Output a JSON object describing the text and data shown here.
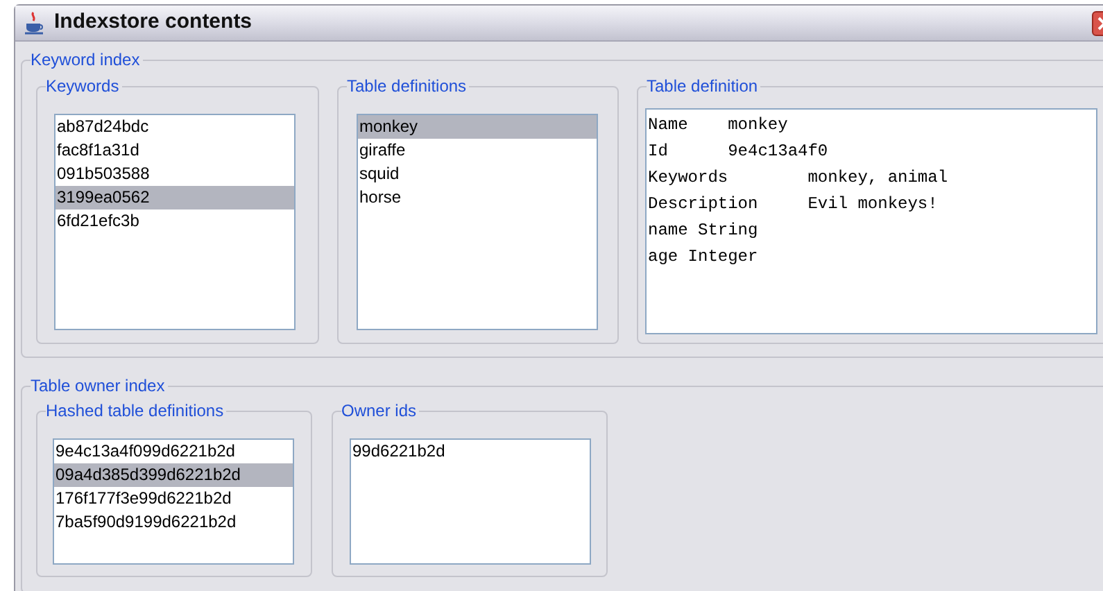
{
  "window": {
    "title": "Indexstore contents"
  },
  "keyword_index": {
    "title": "Keyword index",
    "keywords": {
      "title": "Keywords",
      "items": [
        {
          "label": "ab87d24bdc",
          "selected": false
        },
        {
          "label": "fac8f1a31d",
          "selected": false
        },
        {
          "label": "091b503588",
          "selected": false
        },
        {
          "label": "3199ea0562",
          "selected": true
        },
        {
          "label": "6fd21efc3b",
          "selected": false
        }
      ]
    },
    "table_definitions": {
      "title": "Table definitions",
      "items": [
        {
          "label": "monkey",
          "selected": true
        },
        {
          "label": "giraffe",
          "selected": false
        },
        {
          "label": "squid",
          "selected": false
        },
        {
          "label": "horse",
          "selected": false
        }
      ]
    },
    "table_definition": {
      "title": "Table definition",
      "lines": [
        "Name\tmonkey",
        "Id\t9e4c13a4f0",
        "Keywords\tmonkey, animal",
        "Description\tEvil monkeys!",
        "name String",
        "age Integer"
      ]
    }
  },
  "table_owner_index": {
    "title": "Table owner index",
    "hashed_table_definitions": {
      "title": "Hashed table definitions",
      "items": [
        {
          "label": "9e4c13a4f099d6221b2d",
          "selected": false
        },
        {
          "label": "09a4d385d399d6221b2d",
          "selected": true
        },
        {
          "label": "176f177f3e99d6221b2d",
          "selected": false
        },
        {
          "label": "7ba5f90d9199d6221b2d",
          "selected": false
        }
      ]
    },
    "owner_ids": {
      "title": "Owner ids",
      "items": [
        {
          "label": "99d6221b2d",
          "selected": false
        }
      ]
    }
  }
}
